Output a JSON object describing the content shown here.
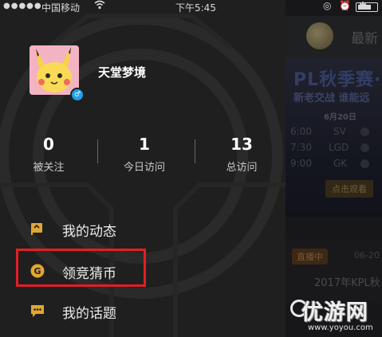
{
  "status_bar": {
    "signal": "●●●●●",
    "carrier": "中国移动",
    "wifi_icon": "wifi-icon",
    "time": "下午5:45",
    "right_icons": "◎ ⏰ ✱",
    "battery_icon": "battery-icon"
  },
  "drawer": {
    "username": "天堂梦境",
    "avatar_badge": "♂",
    "stats": [
      {
        "value": "0",
        "label": "被关注"
      },
      {
        "value": "1",
        "label": "今日访问"
      },
      {
        "value": "13",
        "label": "总访问"
      }
    ],
    "menu": [
      {
        "label": "我的动态",
        "icon": "flag-icon"
      },
      {
        "label": "领竞猜币",
        "icon": "coin-icon",
        "highlighted": true
      },
      {
        "label": "我的话题",
        "icon": "chat-bubble-icon"
      }
    ],
    "colors": {
      "background": "#1f1f1f",
      "icon_gold": "#e0a732",
      "highlight_red": "#e21f24"
    }
  },
  "background_app": {
    "header_title": "最新",
    "banner": {
      "headline": "PL秋季赛·",
      "subline": "新老交战 谁能远",
      "date": "6月20日",
      "schedule": [
        {
          "time": "6:00",
          "team": "SV"
        },
        {
          "time": "7:30",
          "team": "LGD"
        },
        {
          "time": "9:00",
          "team": "GK"
        }
      ],
      "watch_button": "点击观看"
    },
    "card": {
      "live_badge": "直播中",
      "date": "06-20",
      "title": "2017年KPL秋"
    }
  },
  "watermark": {
    "main": "优游网",
    "sub": "www.yoyou.com"
  }
}
